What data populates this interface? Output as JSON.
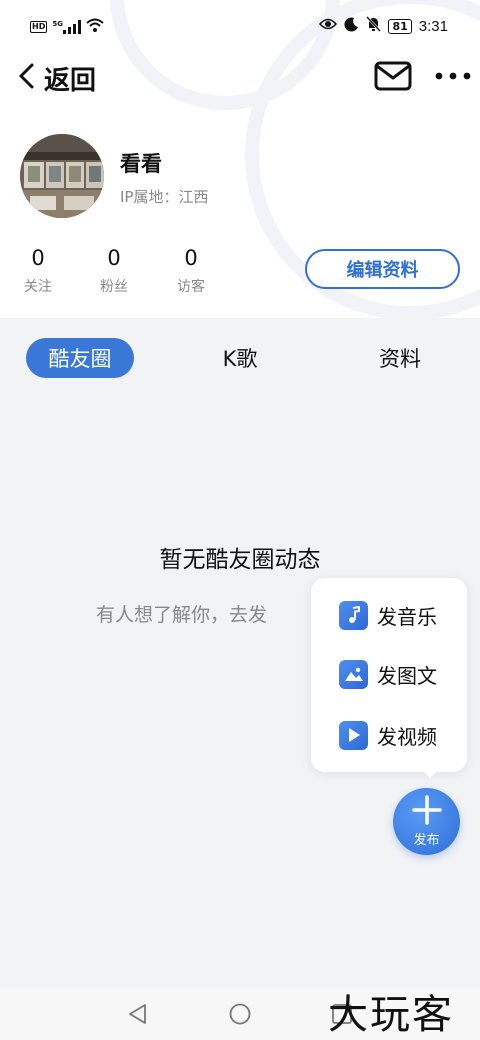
{
  "status_bar": {
    "left_icons": [
      "hd-icon",
      "signal-icon",
      "wifi-icon"
    ],
    "hd_label": "HD",
    "network_label": "5G",
    "battery": "81",
    "time": "3:31"
  },
  "navbar": {
    "back_label": "返回",
    "icons": [
      "mail-icon",
      "more-icon"
    ]
  },
  "profile": {
    "username": "看看",
    "ip_prefix": "IP属地：",
    "ip_location": "江西",
    "stats": [
      {
        "value": "0",
        "label": "关注"
      },
      {
        "value": "0",
        "label": "粉丝"
      },
      {
        "value": "0",
        "label": "访客"
      }
    ],
    "edit_button": "编辑资料"
  },
  "tabs": [
    {
      "label": "酷友圈",
      "active": true
    },
    {
      "label": "K歌",
      "active": false
    },
    {
      "label": "资料",
      "active": false
    }
  ],
  "empty_state": {
    "title": "暂无酷友圈动态",
    "subtitle": "有人想了解你，去发"
  },
  "publish_menu": {
    "items": [
      {
        "label": "发音乐",
        "icon": "music-note-icon"
      },
      {
        "label": "发图文",
        "icon": "image-icon"
      },
      {
        "label": "发视频",
        "icon": "play-icon"
      }
    ],
    "fab_label": "发布"
  },
  "system_nav": {
    "icons": [
      "back-triangle-icon",
      "home-circle-icon",
      "recent-square-icon"
    ]
  },
  "watermark": "大玩客",
  "colors": {
    "accent": "#3a78d8",
    "background": "#f2f3f5"
  }
}
